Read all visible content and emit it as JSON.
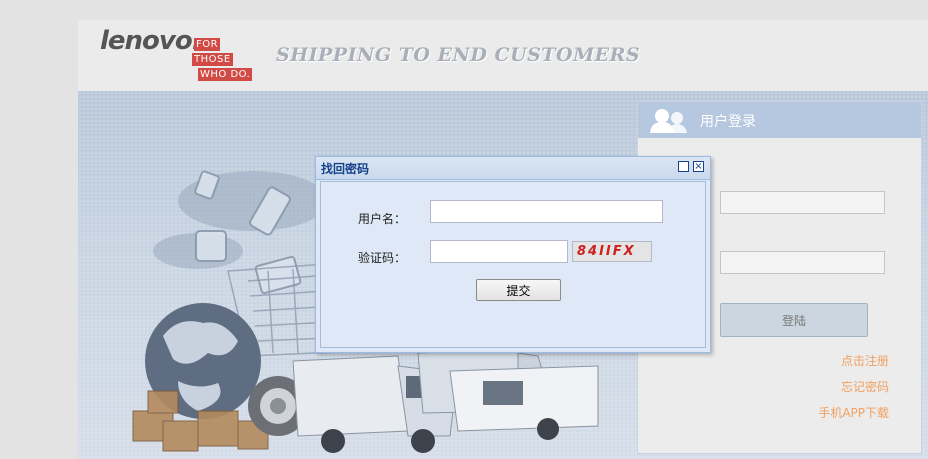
{
  "header": {
    "logo_text": "lenovo.",
    "logo_tag_lines": [
      "FOR",
      "THOSE",
      "WHO DO."
    ],
    "slogan": "SHIPPING TO END CUSTOMERS"
  },
  "login": {
    "title": "用户登录",
    "login_button": "登陆",
    "links": [
      "点击注册",
      "忘记密码",
      "手机APP下载"
    ]
  },
  "dialog": {
    "title": "找回密码",
    "username_label": "用户名：",
    "username_value": "",
    "captcha_label": "验证码：",
    "captcha_value": "",
    "captcha_image_text": "84IIFX",
    "submit_label": "提交"
  },
  "colors": {
    "accent": "#b5c8df",
    "link": "#f0a060",
    "captcha": "#d01f1f",
    "dialog_title": "#15428b"
  }
}
